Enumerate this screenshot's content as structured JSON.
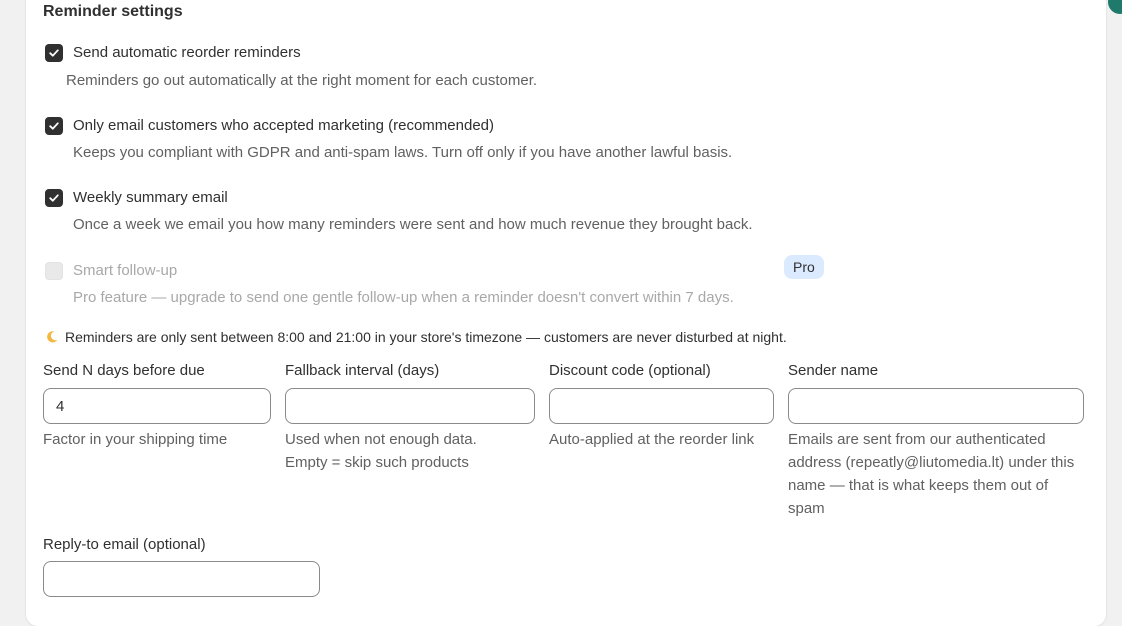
{
  "section": {
    "title": "Reminder settings"
  },
  "options": [
    {
      "label": "Send automatic reorder reminders",
      "help": "Reminders go out automatically at the right moment for each customer.",
      "checked": true,
      "disabled": false
    },
    {
      "label": "Only email customers who accepted marketing (recommended)",
      "help": "Keeps you compliant with GDPR and anti-spam laws. Turn off only if you have another lawful basis.",
      "checked": true,
      "disabled": false
    },
    {
      "label": "Weekly summary email",
      "help": "Once a week we email you how many reminders were sent and how much revenue they brought back.",
      "checked": true,
      "disabled": false
    },
    {
      "label": "Smart follow-up",
      "help": "Pro feature — upgrade to send one gentle follow-up when a reminder doesn't convert within 7 days.",
      "checked": false,
      "disabled": true,
      "badge": "Pro"
    }
  ],
  "notice": {
    "icon": "moon-icon",
    "text": "Reminders are only sent between 8:00 and 21:00 in your store's timezone — customers are never disturbed at night."
  },
  "fields": {
    "days_before": {
      "label": "Send N days before due",
      "value": "4",
      "help": "Factor in your shipping time"
    },
    "fallback_interval": {
      "label": "Fallback interval (days)",
      "value": "",
      "help_lines": [
        "Used when not enough data.",
        "Empty = skip such products"
      ]
    },
    "discount_code": {
      "label": "Discount code (optional)",
      "value": "",
      "help": "Auto-applied at the reorder link"
    },
    "sender_name": {
      "label": "Sender name",
      "value": "",
      "help": "Emails are sent from our authenticated address (repeatly@liutomedia.lt) under this name — that is what keeps them out of spam"
    },
    "reply_to": {
      "label": "Reply-to email (optional)",
      "value": ""
    }
  },
  "colors": {
    "checkbox_checked": "#303030",
    "badge_bg": "#dbeafe",
    "accent": "#1f7a6b"
  }
}
